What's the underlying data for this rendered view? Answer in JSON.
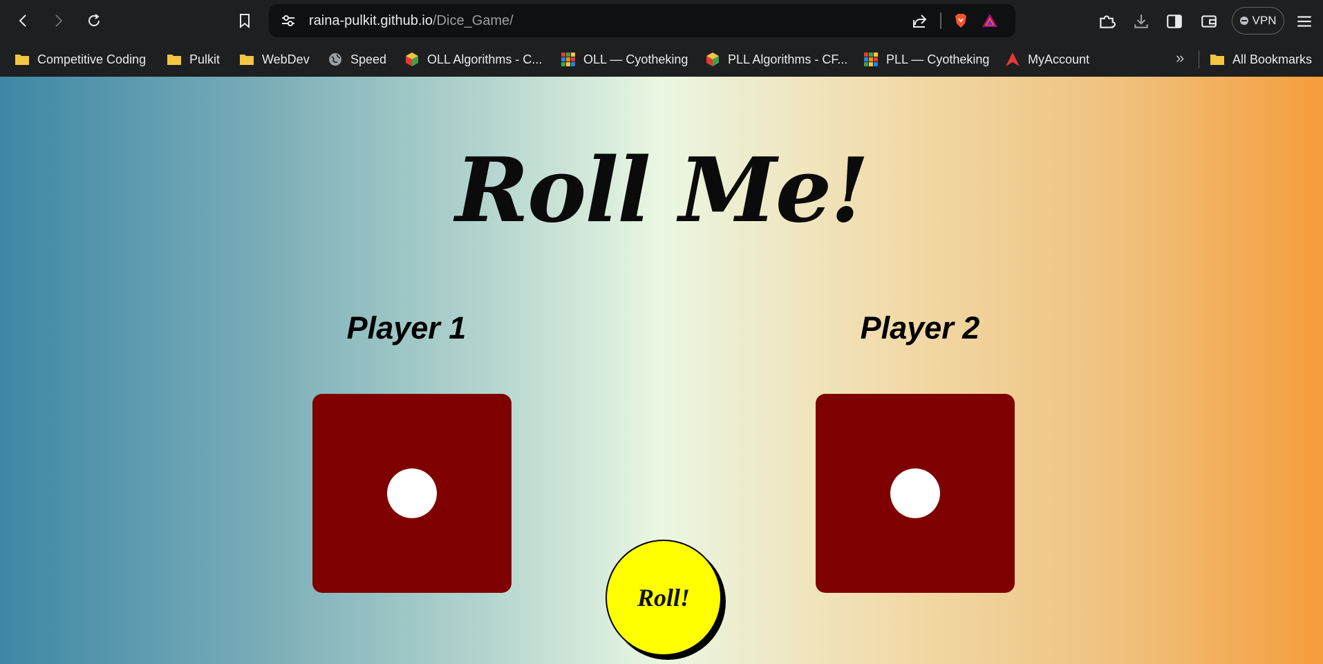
{
  "browser": {
    "url_host": "raina-pulkit.github.io",
    "url_path": "/Dice_Game/",
    "vpn_label": "VPN",
    "icons": [
      "back-icon",
      "forward-icon",
      "reload-icon",
      "bookmark-icon",
      "site-settings-icon",
      "share-icon",
      "brave-shields-icon",
      "brave-rewards-icon",
      "extensions-icon",
      "download-icon",
      "sidebar-icon",
      "wallet-icon",
      "menu-icon"
    ]
  },
  "bookmarks": {
    "items": [
      {
        "label": "Competitive Coding",
        "icon": "folder-icon"
      },
      {
        "label": "Pulkit",
        "icon": "folder-icon"
      },
      {
        "label": "WebDev",
        "icon": "folder-icon"
      },
      {
        "label": "Speed",
        "icon": "globe-icon"
      },
      {
        "label": "OLL Algorithms - C...",
        "icon": "cube-icon"
      },
      {
        "label": "OLL — Cyotheking",
        "icon": "cube-grid-icon"
      },
      {
        "label": "PLL Algorithms - CF...",
        "icon": "cube-icon"
      },
      {
        "label": "PLL — Cyotheking",
        "icon": "cube-grid-icon"
      },
      {
        "label": "MyAccount",
        "icon": "account-logo-icon"
      }
    ],
    "more": "»",
    "all_bookmarks": "All Bookmarks"
  },
  "game": {
    "title": "Roll Me!",
    "player1": "Player 1",
    "player2": "Player 2",
    "player1_die_value": 1,
    "player2_die_value": 1,
    "roll_button": "Roll!",
    "colors": {
      "die": "#7f0000",
      "pip": "#ffffff",
      "button": "#ffff00"
    }
  }
}
